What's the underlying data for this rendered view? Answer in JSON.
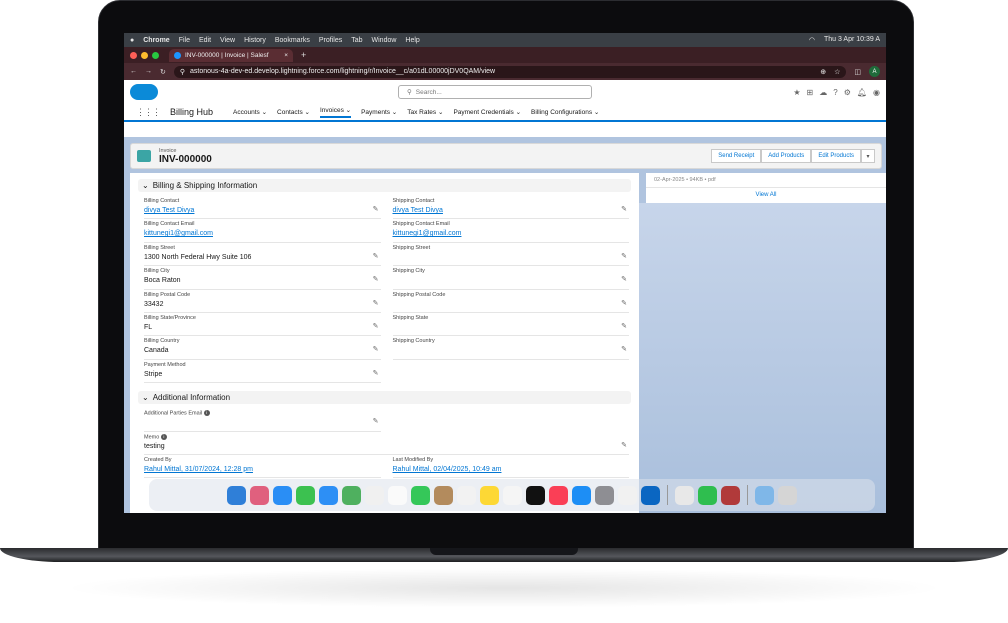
{
  "menubar": {
    "app": "Chrome",
    "items": [
      "File",
      "Edit",
      "View",
      "History",
      "Bookmarks",
      "Profiles",
      "Tab",
      "Window",
      "Help"
    ],
    "clock": "Thu 3 Apr 10:39 A"
  },
  "browser": {
    "tab_title": "INV-000000 | Invoice | Salesf",
    "tab_close": "×",
    "new_tab": "+",
    "url": "astonous-4a-dev-ed.develop.lightning.force.com/lightning/r/Invoice__c/a01dL00000jDV0QAM/view",
    "profile": "A"
  },
  "header": {
    "search_placeholder": "Search..."
  },
  "nav": {
    "app_name": "Billing Hub",
    "items": [
      {
        "label": "Accounts"
      },
      {
        "label": "Contacts"
      },
      {
        "label": "Invoices",
        "active": true
      },
      {
        "label": "Payments"
      },
      {
        "label": "Tax Rates"
      },
      {
        "label": "Payment Credentials"
      },
      {
        "label": "Billing Configurations"
      }
    ]
  },
  "record": {
    "object": "Invoice",
    "name": "INV-000000",
    "actions": [
      "Send Receipt",
      "Add Products",
      "Edit Products"
    ]
  },
  "sections": {
    "billing": "Billing & Shipping Information",
    "additional": "Additional Information"
  },
  "billing_fields": [
    {
      "label": "Billing Contact",
      "value": "divya Test Divya",
      "link": true
    },
    {
      "label": "Shipping Contact",
      "value": "divya Test Divya",
      "link": true
    },
    {
      "label": "Billing Contact Email",
      "value": "kittunegi1@gmail.com",
      "link": true
    },
    {
      "label": "Shipping Contact Email",
      "value": "kittunegi1@gmail.com",
      "link": true
    },
    {
      "label": "Billing Street",
      "value": "1300 North Federal Hwy Suite 106"
    },
    {
      "label": "Shipping Street",
      "value": ""
    },
    {
      "label": "Billing City",
      "value": "Boca Raton"
    },
    {
      "label": "Shipping City",
      "value": ""
    },
    {
      "label": "Billing Postal Code",
      "value": "33432"
    },
    {
      "label": "Shipping Postal Code",
      "value": ""
    },
    {
      "label": "Billing State/Province",
      "value": "FL"
    },
    {
      "label": "Shipping State",
      "value": ""
    },
    {
      "label": "Billing Country",
      "value": "Canada"
    },
    {
      "label": "Shipping Country",
      "value": ""
    },
    {
      "label": "Payment Method",
      "value": "Stripe"
    }
  ],
  "additional": {
    "parties_label": "Additional Parties Email",
    "memo_label": "Memo",
    "memo_value": "testing",
    "created_label": "Created By",
    "created_value": "Rahul Mittal, 31/07/2024, 12:28 pm",
    "modified_label": "Last Modified By",
    "modified_value": "Rahul Mittal, 02/04/2025, 10:49 am"
  },
  "related": {
    "line": "02-Apr-2025 • 94KB • pdf",
    "view_all": "View All"
  }
}
